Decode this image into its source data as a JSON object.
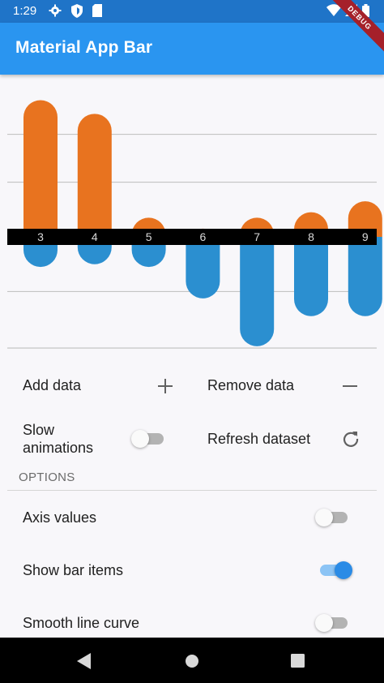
{
  "status_bar": {
    "time": "1:29",
    "icons": [
      "gear-icon",
      "shield-icon",
      "sd-card-icon",
      "wifi-icon",
      "signal-icon",
      "battery-icon"
    ]
  },
  "debug_banner": "DEBUG",
  "app_bar": {
    "title": "Material App Bar"
  },
  "chart_data": {
    "type": "bar",
    "categories": [
      "3",
      "4",
      "5",
      "6",
      "7",
      "8",
      "9"
    ],
    "series": [
      {
        "values": [
          100,
          90,
          14,
          6,
          14,
          18,
          26
        ],
        "color": "#e8731f"
      },
      {
        "values": [
          -22,
          -20,
          -22,
          -45,
          -80,
          -58,
          -58
        ],
        "color": "#2b8fd0"
      }
    ],
    "ylim": [
      -90,
      108
    ],
    "gridlines": [
      75,
      40,
      0,
      -40
    ],
    "grid": true,
    "bar_labels_visible": true
  },
  "controls": {
    "add_data": {
      "label": "Add data",
      "icon": "plus-icon"
    },
    "remove_data": {
      "label": "Remove data",
      "icon": "minus-icon"
    },
    "slow_animations": {
      "label_line1": "Slow",
      "label_line2": "animations",
      "on": false
    },
    "refresh_dataset": {
      "label": "Refresh dataset",
      "icon": "refresh-icon"
    }
  },
  "options": {
    "header": "OPTIONS",
    "axis_values": {
      "label": "Axis values",
      "on": false
    },
    "show_bar_items": {
      "label": "Show bar items",
      "on": true
    },
    "smooth_line_curve": {
      "label": "Smooth line curve",
      "on": false
    }
  },
  "colors": {
    "app_bar": "#2a95f0",
    "status_bar": "#1f74c8",
    "accent": "#2a8be6"
  },
  "nav_bar": {
    "icons": [
      "back-icon",
      "home-icon",
      "recents-icon"
    ]
  }
}
